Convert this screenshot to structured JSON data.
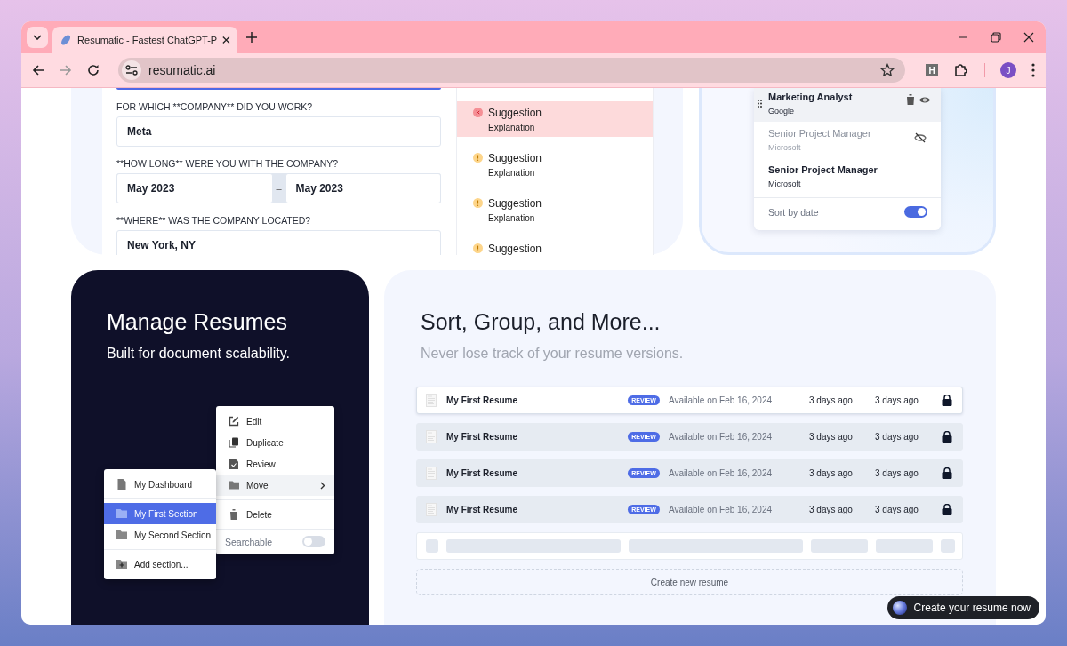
{
  "browser": {
    "tab_title": "Resumatic - Fastest ChatGPT-P",
    "url": "resumatic.ai",
    "extension_label": "H",
    "profile_initial": "J"
  },
  "form": {
    "fields": [
      {
        "kind": "text",
        "label": "FOR WHICH **COMPANY** DID YOU WORK?",
        "value": "Meta"
      },
      {
        "kind": "range",
        "label": "**HOW LONG** WERE YOU WITH THE COMPANY?",
        "start": "May 2023",
        "separator": "–",
        "end": "May 2023"
      },
      {
        "kind": "text",
        "label": "**WHERE** WAS THE COMPANY LOCATED?",
        "value": "New York, NY"
      }
    ]
  },
  "suggestions": [
    {
      "kind": "error",
      "title": "Suggestion",
      "explanation": "Explanation",
      "selected": true
    },
    {
      "kind": "warning",
      "title": "Suggestion",
      "explanation": "Explanation",
      "selected": false
    },
    {
      "kind": "warning",
      "title": "Suggestion",
      "explanation": "Explanation",
      "selected": false
    },
    {
      "kind": "warning",
      "title": "Suggestion",
      "selected": false
    }
  ],
  "experience": {
    "items": [
      {
        "title": "Marketing Analyst",
        "company": "Google",
        "selected": true,
        "hidden": false
      },
      {
        "title": "Senior Project Manager",
        "company": "Microsoft",
        "selected": false,
        "hidden": true
      },
      {
        "title": "Senior Project Manager",
        "company": "Microsoft",
        "selected": false,
        "hidden": false
      }
    ],
    "sort": {
      "label": "Sort by date",
      "on": true
    }
  },
  "manage": {
    "title": "Manage Resumes",
    "subtitle": "Built for document scalability.",
    "context_menu": {
      "groups": [
        [
          {
            "label": "Edit",
            "kind": "action",
            "selected": false
          },
          {
            "label": "Duplicate",
            "kind": "action",
            "selected": false
          },
          {
            "label": "Review",
            "kind": "action",
            "selected": false
          },
          {
            "label": "Move",
            "kind": "submenu",
            "selected": true
          }
        ],
        [
          {
            "label": "Delete",
            "kind": "action",
            "selected": false
          }
        ]
      ],
      "searchable": {
        "label": "Searchable",
        "on": false
      }
    },
    "section_menu": {
      "groups": [
        [
          {
            "label": "My Dashboard",
            "kind": "page",
            "selected": false
          }
        ],
        [
          {
            "label": "My First Section",
            "kind": "section",
            "selected": true
          },
          {
            "label": "My Second Section",
            "kind": "section",
            "selected": false
          }
        ],
        [
          {
            "label": "Add section...",
            "kind": "add",
            "selected": false
          }
        ]
      ]
    }
  },
  "sorting": {
    "title": "Sort, Group, and More...",
    "subtitle": "Never lose track of your resume versions.",
    "rows": [
      {
        "name": "My First Resume",
        "badge": "REVIEW",
        "availability": "Available on Feb 16, 2024",
        "created": "3 days ago",
        "updated": "3 days ago",
        "selected": true
      },
      {
        "name": "My First Resume",
        "badge": "REVIEW",
        "availability": "Available on Feb 16, 2024",
        "created": "3 days ago",
        "updated": "3 days ago",
        "selected": false
      },
      {
        "name": "My First Resume",
        "badge": "REVIEW",
        "availability": "Available on Feb 16, 2024",
        "created": "3 days ago",
        "updated": "3 days ago",
        "selected": false
      },
      {
        "name": "My First Resume",
        "badge": "REVIEW",
        "availability": "Available on Feb 16, 2024",
        "created": "3 days ago",
        "updated": "3 days ago",
        "selected": false
      }
    ],
    "create_button": "Create new resume"
  },
  "cta": {
    "label": "Create your resume now"
  }
}
